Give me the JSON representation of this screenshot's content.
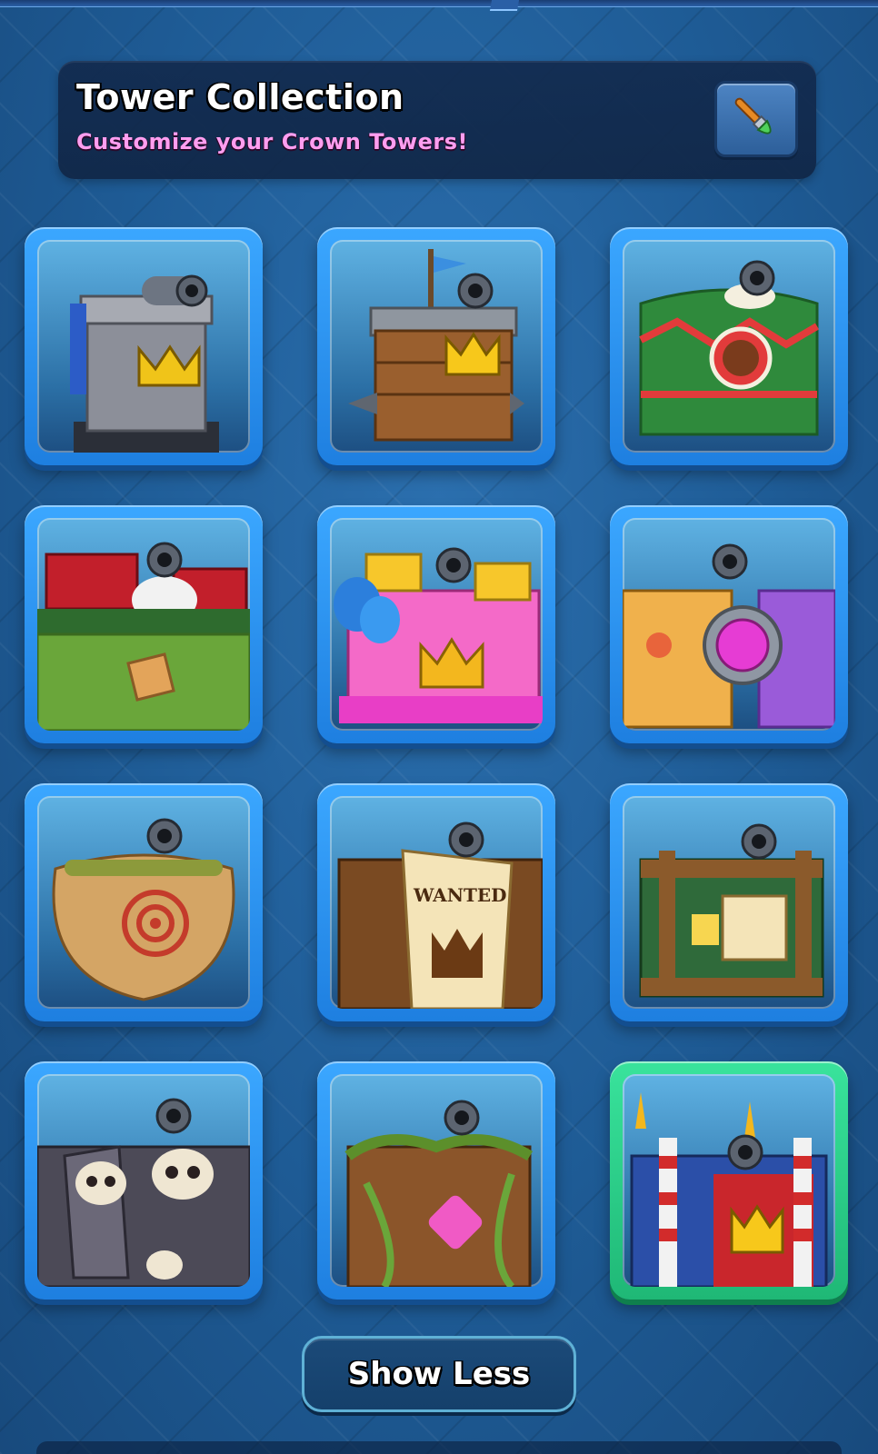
{
  "header": {
    "title": "Tower Collection",
    "subtitle": "Customize your Crown Towers!",
    "edit_icon": "paintbrush-icon"
  },
  "towers": [
    {
      "name": "tower-skin-classic-stone",
      "icon": "stone-tower-icon",
      "selected": false
    },
    {
      "name": "tower-skin-pirate-ship",
      "icon": "ship-tower-icon",
      "selected": false
    },
    {
      "name": "tower-skin-holiday-sweater",
      "icon": "sweater-tower-icon",
      "selected": false
    },
    {
      "name": "tower-skin-goblin-santa",
      "icon": "goblin-tower-icon",
      "selected": false
    },
    {
      "name": "tower-skin-bouncy-castle",
      "icon": "bouncy-castle-tower-icon",
      "selected": false
    },
    {
      "name": "tower-skin-builder-face",
      "icon": "builder-tower-icon",
      "selected": false
    },
    {
      "name": "tower-skin-target-dummy",
      "icon": "target-dummy-tower-icon",
      "selected": false
    },
    {
      "name": "tower-skin-wanted-poster",
      "icon": "wanted-poster-tower-icon",
      "selected": false,
      "poster_text": "WANTED"
    },
    {
      "name": "tower-skin-jungle-board",
      "icon": "jungle-board-tower-icon",
      "selected": false
    },
    {
      "name": "tower-skin-skull-crypt",
      "icon": "skull-tower-icon",
      "selected": false
    },
    {
      "name": "tower-skin-tree-rune",
      "icon": "tree-tower-icon",
      "selected": false
    },
    {
      "name": "tower-skin-festival-tent",
      "icon": "tent-tower-icon",
      "selected": true
    }
  ],
  "footer": {
    "show_less_label": "Show Less"
  },
  "colors": {
    "card_border": "#2a8ff0",
    "card_selected_border": "#2ccf88",
    "subtitle": "#ff9ef0",
    "background": "#1f5a93"
  }
}
